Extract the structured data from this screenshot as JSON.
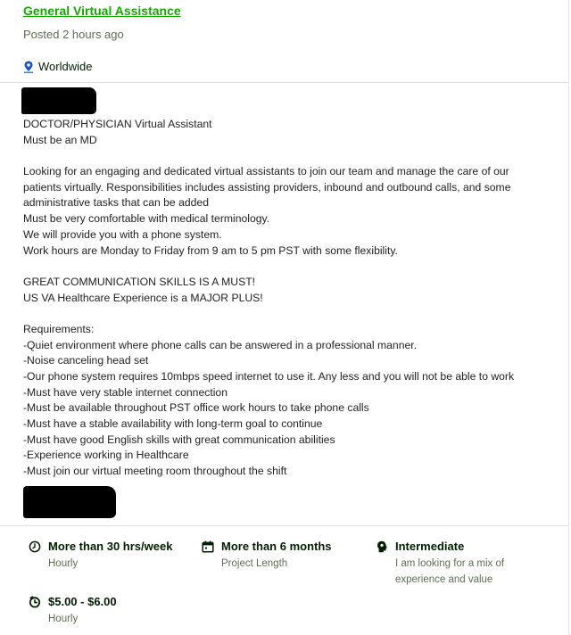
{
  "header": {
    "category": "General Virtual Assistance",
    "posted": "Posted 2 hours ago",
    "location": "Worldwide",
    "location_icon": "location-pin-icon"
  },
  "description": {
    "lines": [
      "DOCTOR/PHYSICIAN Virtual Assistant",
      "Must be an MD",
      "",
      "Looking for an engaging and dedicated virtual assistants to join our team and manage the care of our",
      "patients virtually.  Responsibilities includes assisting providers, inbound and outbound calls, and some",
      "administrative tasks that can be added",
      "Must be very comfortable with medical terminology.",
      "We will provide you with a phone system.",
      "Work hours are Monday to Friday from 9 am to 5 pm PST with some flexibility.",
      "",
      "GREAT COMMUNICATION SKILLS IS A MUST!",
      "US VA Healthcare Experience is a MAJOR PLUS!",
      "",
      "Requirements:",
      "-Quiet environment where phone calls can be answered in a professional manner.",
      "-Noise canceling head set",
      "-Our phone system requires 10mbps speed internet to use it. Any less and you will not be able to work",
      "-Must have very stable internet connection",
      "-Must be available throughout PST office work hours to take phone calls",
      "-Must have a stable availability with long-term goal to continue",
      "-Must have good English skills with great communication abilities",
      "-Experience working in Healthcare",
      "-Must join our virtual meeting room throughout the shift"
    ]
  },
  "features": {
    "hours": {
      "title": "More than 30 hrs/week",
      "sub": "Hourly",
      "icon": "clock-icon"
    },
    "duration": {
      "title": "More than 6 months",
      "sub": "Project Length",
      "icon": "calendar-icon"
    },
    "level": {
      "title": "Intermediate",
      "sub1": "I am looking for a mix of",
      "sub2": "experience and value",
      "icon": "experience-level-icon"
    },
    "rate": {
      "title": "$5.00 - $6.00",
      "sub": "Hourly",
      "icon": "hourly-rate-icon"
    }
  },
  "colors": {
    "accent": "#14a800",
    "text": "#222222",
    "muted": "#5e6d55",
    "redaction": "#000000"
  }
}
